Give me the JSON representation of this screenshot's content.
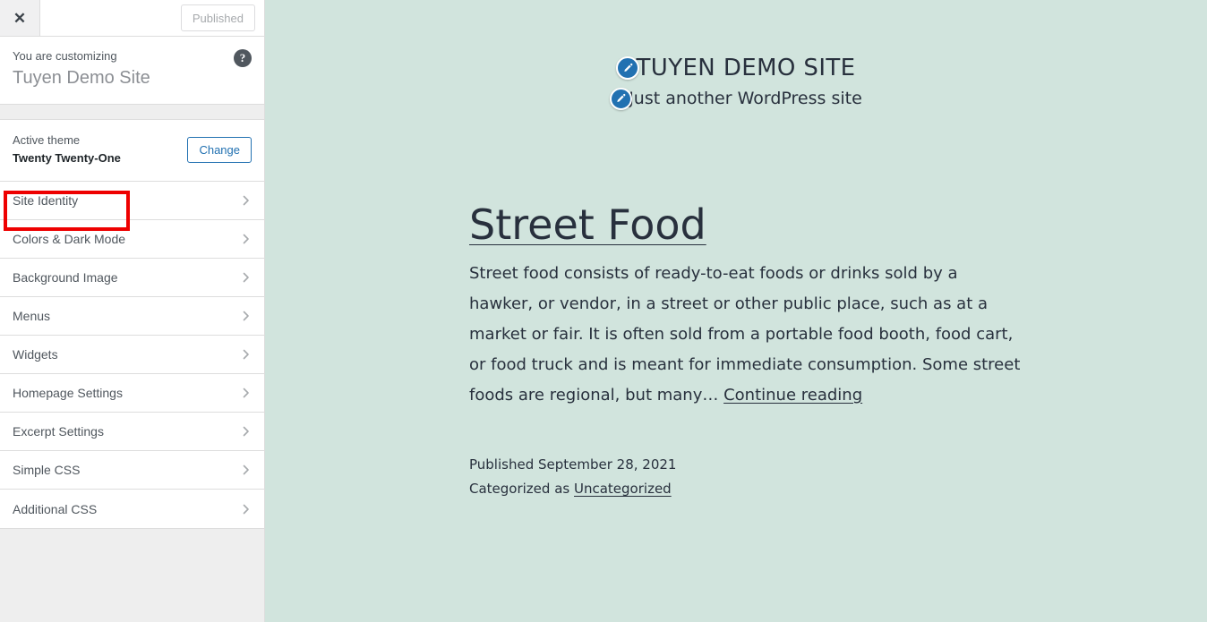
{
  "customizer": {
    "close_icon": "close-icon",
    "publish_label": "Published",
    "help_icon": "help-icon",
    "customizing_label": "You are customizing",
    "site_name": "Tuyen Demo Site",
    "theme_label": "Active theme",
    "theme_name": "Twenty Twenty-One",
    "change_label": "Change",
    "panels": [
      {
        "label": "Site Identity",
        "highlighted": true
      },
      {
        "label": "Colors & Dark Mode",
        "highlighted": false
      },
      {
        "label": "Background Image",
        "highlighted": false
      },
      {
        "label": "Menus",
        "highlighted": false
      },
      {
        "label": "Widgets",
        "highlighted": false
      },
      {
        "label": "Homepage Settings",
        "highlighted": false
      },
      {
        "label": "Excerpt Settings",
        "highlighted": false
      },
      {
        "label": "Simple CSS",
        "highlighted": false
      },
      {
        "label": "Additional CSS",
        "highlighted": false
      }
    ],
    "highlight_color": "#ee0000",
    "accent_color": "#2271b1"
  },
  "preview": {
    "background_color": "#d1e4dd",
    "site_title": "TUYEN DEMO SITE",
    "site_description": "Just another WordPress site",
    "edit_icon": "pencil-icon",
    "post": {
      "title": "Street Food",
      "excerpt": "Street food consists of ready-to-eat foods or drinks sold by a hawker, or vendor, in a street or other public place, such as at a market or fair. It is often sold from a portable food booth, food cart, or food truck and is meant for immediate consumption. Some street foods are regional, but many…",
      "continue_label": "Continue reading",
      "published_text": "Published September 28, 2021",
      "categorized_prefix": "Categorized as",
      "category": "Uncategorized"
    }
  }
}
